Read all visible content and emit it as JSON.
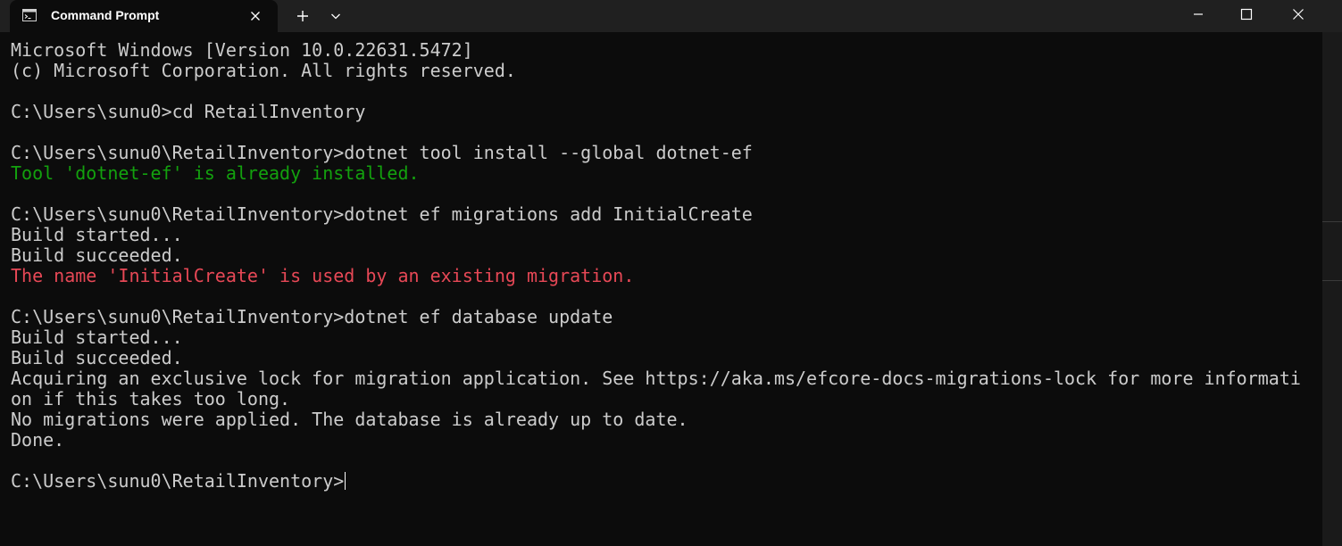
{
  "window": {
    "tab_title": "Command Prompt",
    "tab_icon": "cmd-icon",
    "buttons": {
      "new_tab": "plus-icon",
      "dropdown": "chevron-down-icon",
      "minimize": "minimize-icon",
      "maximize": "maximize-icon",
      "close": "close-icon"
    }
  },
  "colors": {
    "background": "#0c0c0c",
    "titlebar": "#202020",
    "text": "#cccccc",
    "success": "#13a10e",
    "error": "#e74856"
  },
  "terminal": {
    "lines": [
      {
        "text": "Microsoft Windows [Version 10.0.22631.5472]",
        "style": "normal"
      },
      {
        "text": "(c) Microsoft Corporation. All rights reserved.",
        "style": "normal"
      },
      {
        "text": "",
        "style": "normal"
      },
      {
        "text": "C:\\Users\\sunu0>cd RetailInventory",
        "style": "normal"
      },
      {
        "text": "",
        "style": "normal"
      },
      {
        "text": "C:\\Users\\sunu0\\RetailInventory>dotnet tool install --global dotnet-ef",
        "style": "normal"
      },
      {
        "text": "Tool 'dotnet-ef' is already installed.",
        "style": "green"
      },
      {
        "text": "",
        "style": "normal"
      },
      {
        "text": "C:\\Users\\sunu0\\RetailInventory>dotnet ef migrations add InitialCreate",
        "style": "normal"
      },
      {
        "text": "Build started...",
        "style": "normal"
      },
      {
        "text": "Build succeeded.",
        "style": "normal"
      },
      {
        "text": "The name 'InitialCreate' is used by an existing migration.",
        "style": "red"
      },
      {
        "text": "",
        "style": "normal"
      },
      {
        "text": "C:\\Users\\sunu0\\RetailInventory>dotnet ef database update",
        "style": "normal"
      },
      {
        "text": "Build started...",
        "style": "normal"
      },
      {
        "text": "Build succeeded.",
        "style": "normal"
      },
      {
        "text": "Acquiring an exclusive lock for migration application. See https://aka.ms/efcore-docs-migrations-lock for more informati",
        "style": "normal"
      },
      {
        "text": "on if this takes too long.",
        "style": "normal"
      },
      {
        "text": "No migrations were applied. The database is already up to date.",
        "style": "normal"
      },
      {
        "text": "Done.",
        "style": "normal"
      },
      {
        "text": "",
        "style": "normal"
      }
    ],
    "prompt": "C:\\Users\\sunu0\\RetailInventory>"
  }
}
